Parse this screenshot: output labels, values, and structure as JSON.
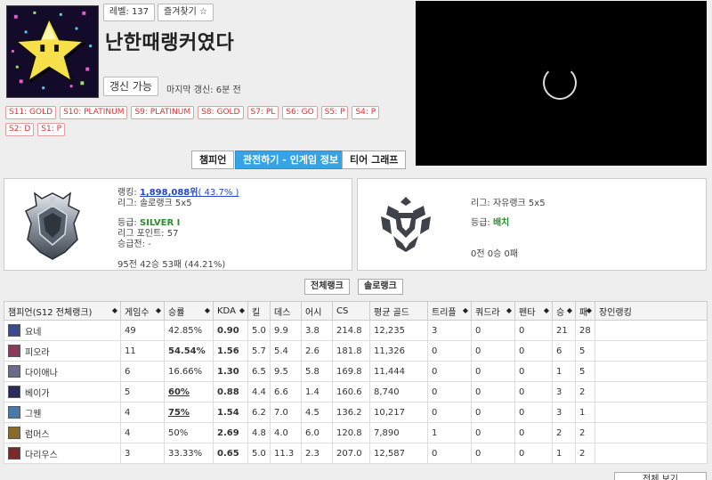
{
  "header": {
    "level": "레벨: 137",
    "favorite_label": "즐겨찾기 ☆",
    "summoner_name": "난한때랭커였다",
    "refresh_label": "갱신 가능",
    "last_update": "마지막 갱신: 6분 전"
  },
  "season_tiers": [
    "S11: GOLD",
    "S10: PLATINUM",
    "S9: PLATINUM",
    "S8: GOLD",
    "S7: PL",
    "S6: GO",
    "S5: P",
    "S4: P",
    "S2: D",
    "S1: P"
  ],
  "tabs": [
    {
      "label": "챔피언"
    },
    {
      "label": "관전하기 - 인게임 정보"
    },
    {
      "label": "티어 그래프"
    }
  ],
  "solo_rank": {
    "ranking_prefix": "랭킹: ",
    "ranking_value": "1,898,088위",
    "ranking_percent": "( 43.7% )",
    "league": "리그: 솔로랭크 5x5",
    "tier_prefix": "등급: ",
    "tier": "SILVER I",
    "league_points": "리그 포인트: 57",
    "promotion": "승급전: -",
    "record": "95전 42승 53패 (44.21%)"
  },
  "flex_rank": {
    "league": "리그: 자유랭크 5x5",
    "tier_prefix": "등급: ",
    "tier": "배치",
    "record": "0전 0승 0패"
  },
  "filters": {
    "all_rank": "전체랭크",
    "solo_rank": "솔로랭크"
  },
  "table": {
    "headers": [
      "챔피언(S12 전체랭크)",
      "게임수",
      "승률",
      "KDA",
      "킬",
      "데스",
      "어시",
      "CS",
      "평균 골드",
      "트리플",
      "쿼드라",
      "펜타",
      "승",
      "패",
      "장인랭킹"
    ],
    "rows": [
      {
        "champion": "요네",
        "games": "49",
        "winrate": "42.85%",
        "kda": "0.90",
        "kills": "5.0",
        "deaths": "9.9",
        "assists": "3.8",
        "cs": "214.8",
        "gold": "12,235",
        "triple": "3",
        "quadra": "0",
        "penta": "0",
        "wins": "21",
        "losses": "28",
        "mastery_rank": "",
        "avatar_color": "#3a4a8a"
      },
      {
        "champion": "피오라",
        "games": "11",
        "winrate": "54.54%",
        "kda": "1.56",
        "kills": "5.7",
        "deaths": "5.4",
        "assists": "2.6",
        "cs": "181.8",
        "gold": "11,326",
        "triple": "0",
        "quadra": "0",
        "penta": "0",
        "wins": "6",
        "losses": "5",
        "mastery_rank": "",
        "avatar_color": "#8a3a5a"
      },
      {
        "champion": "다이애나",
        "games": "6",
        "winrate": "16.66%",
        "kda": "1.30",
        "kills": "6.5",
        "deaths": "9.5",
        "assists": "5.8",
        "cs": "169.8",
        "gold": "11,444",
        "triple": "0",
        "quadra": "0",
        "penta": "0",
        "wins": "1",
        "losses": "5",
        "mastery_rank": "",
        "avatar_color": "#6a6a8a"
      },
      {
        "champion": "베이가",
        "games": "5",
        "winrate": "60%",
        "kda": "0.88",
        "kills": "4.4",
        "deaths": "6.6",
        "assists": "1.4",
        "cs": "160.6",
        "gold": "8,740",
        "triple": "0",
        "quadra": "0",
        "penta": "0",
        "wins": "3",
        "losses": "2",
        "mastery_rank": "",
        "avatar_color": "#2a2a5a"
      },
      {
        "champion": "그웬",
        "games": "4",
        "winrate": "75%",
        "kda": "1.54",
        "kills": "6.2",
        "deaths": "7.0",
        "assists": "4.5",
        "cs": "136.2",
        "gold": "10,217",
        "triple": "0",
        "quadra": "0",
        "penta": "0",
        "wins": "3",
        "losses": "1",
        "mastery_rank": "",
        "avatar_color": "#4a7aaa"
      },
      {
        "champion": "럼머스",
        "games": "4",
        "winrate": "50%",
        "kda": "2.69",
        "kills": "4.8",
        "deaths": "4.0",
        "assists": "6.0",
        "cs": "120.8",
        "gold": "7,890",
        "triple": "1",
        "quadra": "0",
        "penta": "0",
        "wins": "2",
        "losses": "2",
        "mastery_rank": "",
        "avatar_color": "#8a6a2a"
      },
      {
        "champion": "다리우스",
        "games": "3",
        "winrate": "33.33%",
        "kda": "0.65",
        "kills": "5.0",
        "deaths": "11.3",
        "assists": "2.3",
        "cs": "207.0",
        "gold": "12,587",
        "triple": "0",
        "quadra": "0",
        "penta": "0",
        "wins": "1",
        "losses": "2",
        "mastery_rank": "",
        "avatar_color": "#7a2a2a"
      }
    ]
  },
  "colors": {
    "tab_active": "#35a4e6",
    "badge_red": "#d33",
    "winrate_blue": "#3c4cc4",
    "winrate_red": "#d04040",
    "kda_green": "#2a8f2a"
  },
  "more_label": "전체 보기"
}
